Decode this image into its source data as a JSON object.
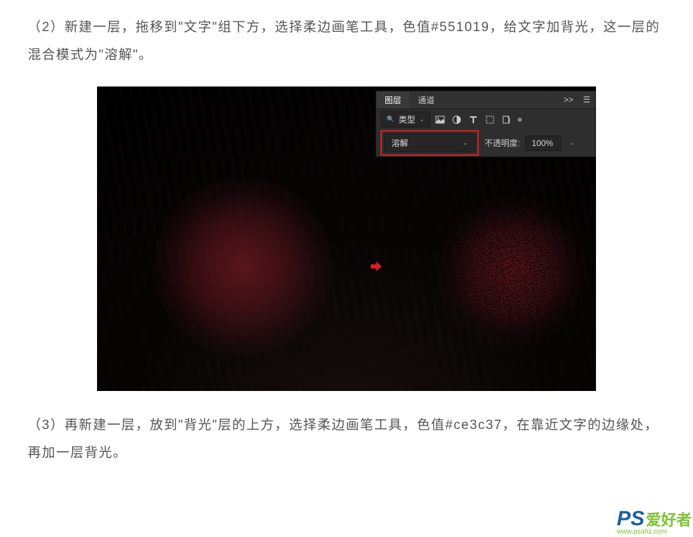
{
  "step2": "（2）新建一层，拖移到\"文字\"组下方，选择柔边画笔工具，色值#551019，给文字加背光，这一层的混合模式为\"溶解\"。",
  "step3": "（3）再新建一层，放到\"背光\"层的上方，选择柔边画笔工具，色值#ce3c37，在靠近文字的边缘处，再加一层背光。",
  "panel": {
    "tab_layers": "图层",
    "tab_channels": "通道",
    "expand": ">>",
    "type_filter": "类型",
    "blend_mode": "溶解",
    "opacity_label": "不透明度:",
    "opacity_value": "100%"
  },
  "watermark": {
    "ps": "PS",
    "cn": "爱好者",
    "url": "www.psahz.com"
  }
}
